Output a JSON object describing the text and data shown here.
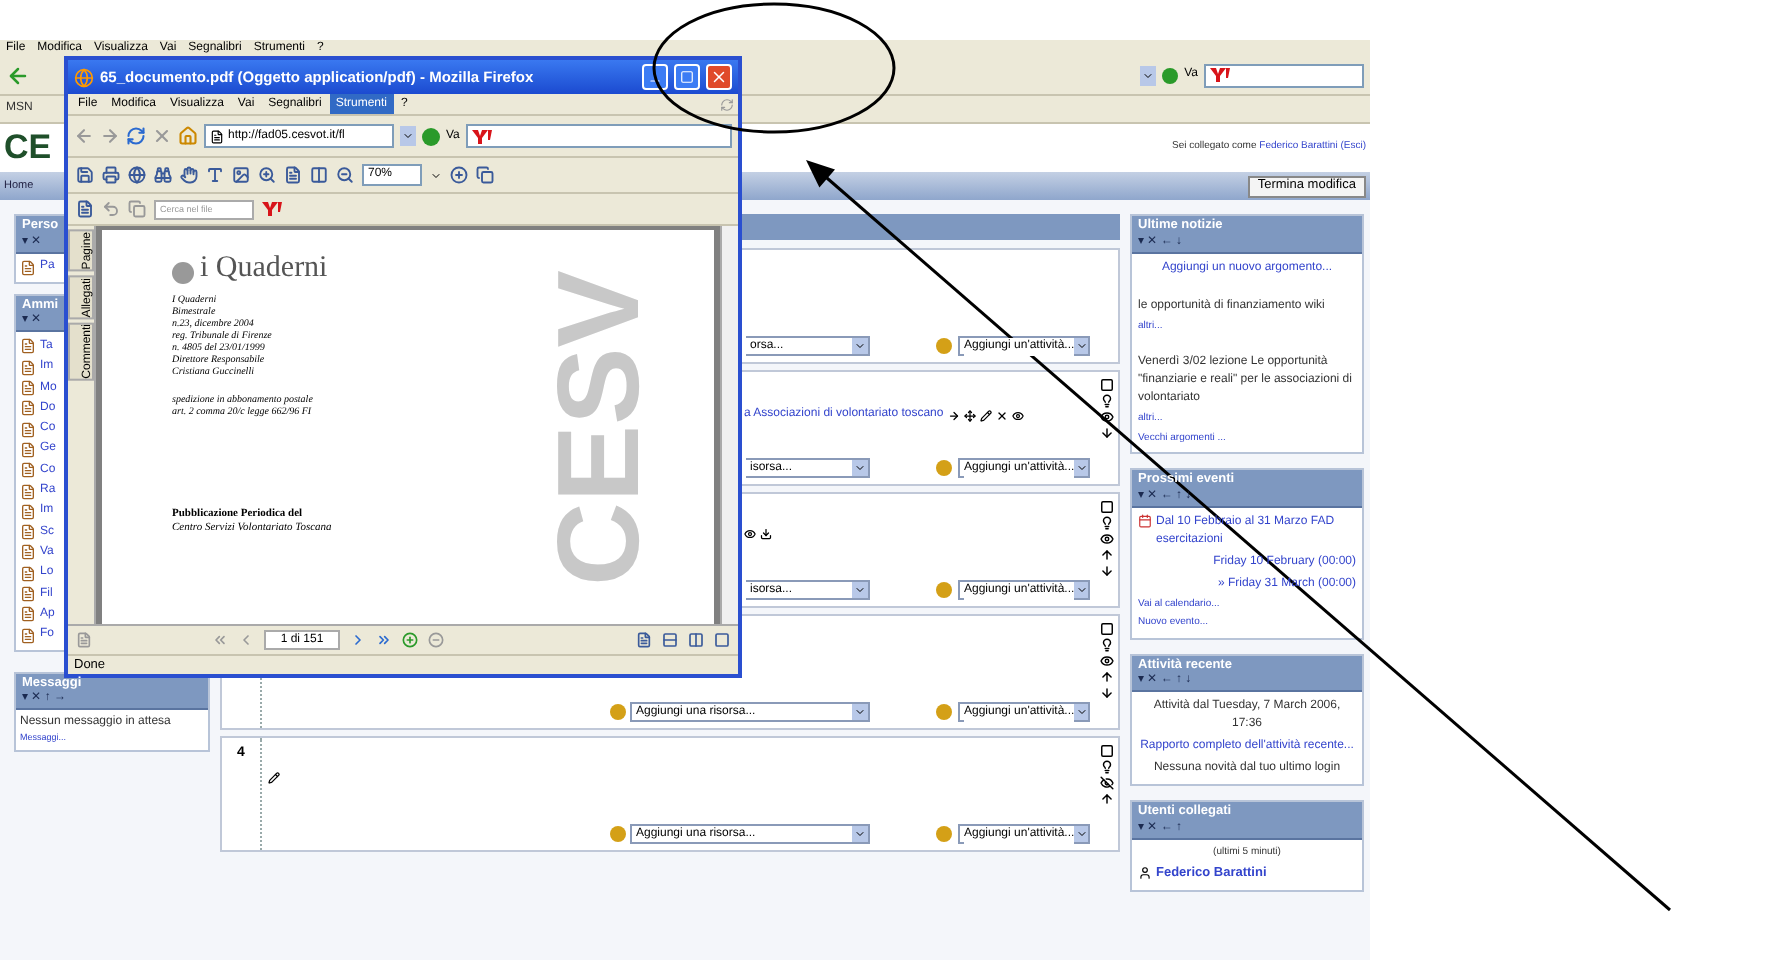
{
  "background_browser": {
    "menu": [
      "File",
      "Modifica",
      "Visualizza",
      "Vai",
      "Segnalibri",
      "Strumenti",
      "?"
    ],
    "go_label": "Va",
    "bookmark": "MSN",
    "logo": "CE",
    "login": {
      "prefix": "Sei collegato come",
      "user": "Federico Barattini",
      "logout": "(Esci)"
    },
    "nav_link": "Home",
    "edit_button": "Termina modifica"
  },
  "left_blocks": [
    {
      "title": "Perso",
      "controls": "▾ ✕",
      "items": [
        "Pa"
      ]
    },
    {
      "title": "Ammi",
      "controls": "▾ ✕",
      "items": [
        "Ta",
        "Im",
        "Mo",
        "Do",
        "Co",
        "Ge",
        "Co",
        "Ra",
        "Im",
        "Sc",
        "Va",
        "Lo",
        "Fil",
        "Ap",
        "Fo"
      ]
    }
  ],
  "messages_block": {
    "title": "Messaggi",
    "controls": "▾ ✕ ↑ →",
    "text": "Nessun messaggio in attesa",
    "link": "Messaggi..."
  },
  "sections": [
    {
      "resource": {
        "text": "orsa...",
        "cut": true
      },
      "activity": "Aggiungi un'attività..."
    },
    {
      "content": [
        {
          "text": "a Associazioni di volontariato toscano",
          "icons": [
            {
              "kind": "right"
            },
            {
              "kind": "move"
            },
            {
              "kind": "edit"
            },
            {
              "kind": "delete"
            },
            {
              "kind": "eye"
            }
          ]
        }
      ],
      "resource": {
        "text": "isorsa...",
        "cut": true
      },
      "activity": "Aggiungi un'attività...",
      "tools": [
        {
          "kind": "square"
        },
        {
          "kind": "bulb"
        },
        {
          "kind": "eye"
        },
        {
          "kind": "down"
        }
      ]
    },
    {
      "content": [
        {
          "icons": [
            {
              "kind": "eye"
            },
            {
              "kind": "download"
            }
          ]
        }
      ],
      "resource": {
        "text": "isorsa...",
        "cut": true
      },
      "activity": "Aggiungi un'attività...",
      "tools": [
        {
          "kind": "square"
        },
        {
          "kind": "bulb"
        },
        {
          "kind": "eye"
        },
        {
          "kind": "up"
        },
        {
          "kind": "down"
        }
      ]
    },
    {
      "resource": {
        "text": "Aggiungi una risorsa...",
        "cut": false
      },
      "activity": "Aggiungi un'attività...",
      "tools": [
        {
          "kind": "square"
        },
        {
          "kind": "bulb"
        },
        {
          "kind": "eye"
        },
        {
          "kind": "up"
        },
        {
          "kind": "down"
        }
      ]
    },
    {
      "number": "4",
      "content": [
        {
          "icons": [
            {
              "kind": "edit"
            }
          ]
        }
      ],
      "resource": {
        "text": "Aggiungi una risorsa...",
        "cut": false
      },
      "activity": "Aggiungi un'attività...",
      "tools": [
        {
          "kind": "square"
        },
        {
          "kind": "bulb"
        },
        {
          "kind": "hidden"
        },
        {
          "kind": "up"
        }
      ]
    }
  ],
  "right_blocks": [
    {
      "title": "Ultime notizie",
      "controls": "▾ ✕ ← ↓",
      "entries": [
        {
          "kind": "centered_link",
          "text": "Aggiungi un nuovo argomento..."
        },
        {
          "kind": "text",
          "text": "le opportunità di finanziamento wiki"
        },
        {
          "kind": "small_link",
          "text": "altri..."
        },
        {
          "kind": "text",
          "text": "Venerdì 3/02 lezione Le opportunità \"finanziarie e reali\" per le associazioni di volontariato"
        },
        {
          "kind": "small_link",
          "text": "altri..."
        },
        {
          "kind": "small_link",
          "text": "Vecchi argomenti ..."
        }
      ]
    },
    {
      "title": "Prossimi eventi",
      "controls": "▾ ✕ ← ↑ ↓",
      "entries": [
        {
          "kind": "event",
          "text": "Dal 10 Febbraio al 31 Marzo FAD esercitazioni"
        },
        {
          "kind": "date",
          "text": "Friday 10 February (00:00)"
        },
        {
          "kind": "date",
          "text": "» Friday 31 March (00:00)"
        },
        {
          "kind": "small_link",
          "text": "Vai al calendario..."
        },
        {
          "kind": "small_link",
          "text": "Nuovo evento..."
        }
      ]
    },
    {
      "title": "Attività recente",
      "controls": "▾ ✕ ← ↑ ↓",
      "entries": [
        {
          "kind": "centered_text",
          "text": "Attività dal Tuesday, 7 March 2006, 17:36"
        },
        {
          "kind": "centered_link",
          "text": "Rapporto completo dell'attività recente..."
        },
        {
          "kind": "centered_text",
          "text": "Nessuna novità dal tuo ultimo login"
        }
      ]
    },
    {
      "title": "Utenti collegati",
      "controls": "▾ ✕ ← ↑",
      "entries": [
        {
          "kind": "note",
          "text": "(ultimi 5 minuti)"
        },
        {
          "kind": "user",
          "text": "Federico Barattini"
        }
      ]
    }
  ],
  "popup": {
    "title": "65_documento.pdf (Oggetto application/pdf) - Mozilla Firefox",
    "menu": [
      {
        "label": "File",
        "selected": false
      },
      {
        "label": "Modifica",
        "selected": false
      },
      {
        "label": "Visualizza",
        "selected": false
      },
      {
        "label": "Vai",
        "selected": false
      },
      {
        "label": "Segnalibri",
        "selected": false
      },
      {
        "label": "Strumenti",
        "selected": true
      },
      {
        "label": "?",
        "selected": false
      }
    ],
    "address": "http://fad05.cesvot.it/fl",
    "go_label": "Va",
    "zoom": "70%",
    "search_placeholder": "Cerca nel file",
    "side_tabs": [
      "Pagine",
      "Allegati",
      "Commenti"
    ],
    "document": {
      "heading": "i Quaderni",
      "lines": [
        "I Quaderni",
        "Bimestrale",
        "n.23, dicembre 2004",
        "reg. Tribunale di Firenze",
        "n. 4805 del 23/01/1999",
        "Direttore Responsabile",
        "Cristiana Guccinelli"
      ],
      "postal_lines": [
        "spedizione in abbonamento postale",
        "art. 2 comma 20/c legge 662/96 FI"
      ],
      "footer_lines": [
        "Pubblicazione Periodica del",
        "Centro Servizi Volontariato Toscana"
      ],
      "big_letters": "CESV"
    },
    "page_field": "1 di 151",
    "status": "Done"
  }
}
